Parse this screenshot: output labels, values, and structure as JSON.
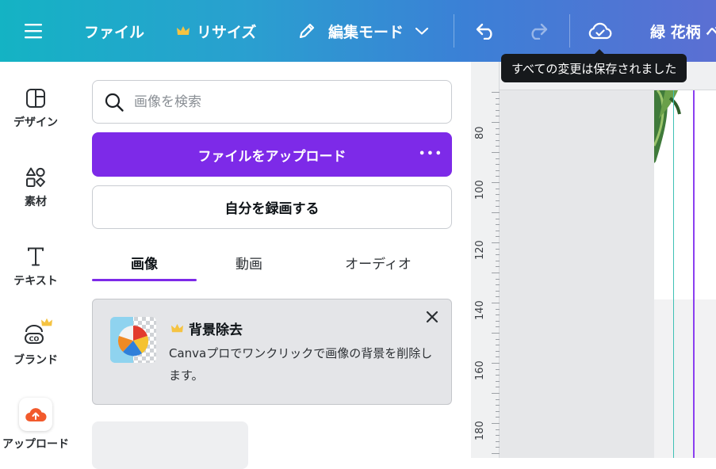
{
  "topbar": {
    "menu_icon": "hamburger-icon",
    "file_label": "ファイル",
    "resize_label": "リサイズ",
    "edit_mode_label": "編集モード",
    "undo_icon": "undo-icon",
    "redo_icon": "redo-icon",
    "cloud_icon": "cloud-check-icon",
    "project_title": "緑 花柄 ベ",
    "tooltip": "すべての変更は保存されました",
    "crown_color": "#f5c342"
  },
  "rail": {
    "items": [
      {
        "label": "デザイン",
        "icon": "layout-icon"
      },
      {
        "label": "素材",
        "icon": "elements-icon"
      },
      {
        "label": "テキスト",
        "icon": "text-icon"
      },
      {
        "label": "ブランド",
        "icon": "brand-icon"
      },
      {
        "label": "アップロード",
        "icon": "upload-cloud-icon"
      }
    ]
  },
  "panel": {
    "search_placeholder": "画像を検索",
    "upload_button": "ファイルをアップロード",
    "upload_more": "•••",
    "record_button": "自分を録画する",
    "tabs": [
      "画像",
      "動画",
      "オーディオ"
    ],
    "active_tab": 0,
    "promo": {
      "title": "背景除去",
      "body": "Canvaプロでワンクリックで画像の背景を削除します。"
    }
  },
  "ruler": {
    "labels": [
      "80",
      "100",
      "120",
      "140",
      "160",
      "180"
    ]
  },
  "colors": {
    "accent_purple": "#7d2ae8",
    "guide_teal": "#3fc1b5",
    "guide_purple": "#8b3ff0"
  }
}
